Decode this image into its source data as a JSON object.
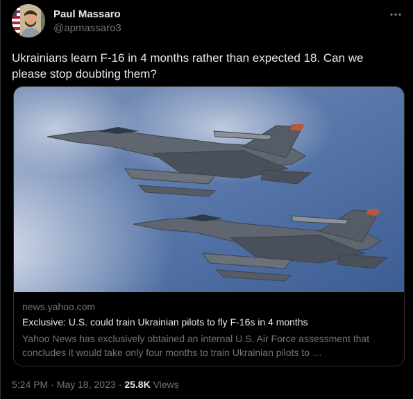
{
  "author": {
    "name": "Paul Massaro",
    "handle": "@apmassaro3"
  },
  "tweet": {
    "text": "Ukrainians learn F-16 in 4 months rather than expected 18. Can we please stop doubting them?"
  },
  "card": {
    "domain": "news.yahoo.com",
    "title": "Exclusive: U.S. could train Ukrainian pilots to fly F-16s in 4 months",
    "description": "Yahoo News has exclusively obtained an internal U.S. Air Force assessment that concludes it would take only four months to train Ukrainian pilots to …"
  },
  "meta": {
    "time": "5:24 PM",
    "separator": "·",
    "date": "May 18, 2023",
    "views_count": "25.8K",
    "views_label": "Views"
  },
  "icons": {
    "more": "more-icon"
  },
  "colors": {
    "background": "#000000",
    "text_primary": "#e7e9ea",
    "text_secondary": "#71767b",
    "border": "#2f3336"
  }
}
